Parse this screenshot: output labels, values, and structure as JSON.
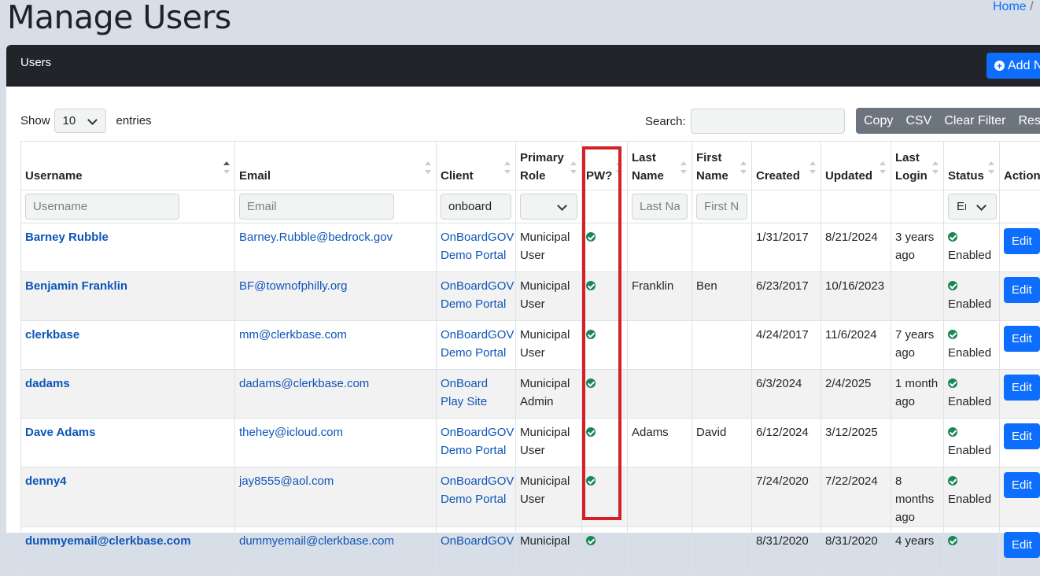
{
  "page": {
    "title": "Manage Users"
  },
  "breadcrumb": {
    "home": "Home",
    "sep": "/"
  },
  "card": {
    "title": "Users",
    "add_label": "Add N"
  },
  "length": {
    "show": "Show",
    "value": "10",
    "entries": "entries"
  },
  "search": {
    "label": "Search:",
    "value": ""
  },
  "buttons": [
    "Copy",
    "CSV",
    "Clear Filter",
    "Reset"
  ],
  "columns": [
    {
      "key": "username",
      "label": "Username"
    },
    {
      "key": "email",
      "label": "Email"
    },
    {
      "key": "client",
      "label": "Client"
    },
    {
      "key": "role",
      "label": "Primary Role"
    },
    {
      "key": "pw",
      "label": "PW?"
    },
    {
      "key": "last",
      "label": "Last Name"
    },
    {
      "key": "first",
      "label": "First Name"
    },
    {
      "key": "created",
      "label": "Created"
    },
    {
      "key": "updated",
      "label": "Updated"
    },
    {
      "key": "login",
      "label": "Last Login"
    },
    {
      "key": "status",
      "label": "Status"
    },
    {
      "key": "action",
      "label": "Action"
    }
  ],
  "filters": {
    "username": "Username",
    "email": "Email",
    "client": "onboard",
    "last": "Last Name",
    "first": "First Name",
    "status": "Enabled"
  },
  "rows": [
    {
      "username": "Barney Rubble",
      "email": "Barney.Rubble@bedrock.gov",
      "client": "OnBoardGOV Demo Portal",
      "role": "Municipal User",
      "last": "",
      "first": "",
      "created": "1/31/2017",
      "updated": "8/21/2024",
      "login": "3 years ago",
      "status": "Enabled",
      "action": "Edit"
    },
    {
      "username": "Benjamin Franklin",
      "email": "BF@townofphilly.org",
      "client": "OnBoardGOV Demo Portal",
      "role": "Municipal User",
      "last": "Franklin",
      "first": "Ben",
      "created": "6/23/2017",
      "updated": "10/16/2023",
      "login": "",
      "status": "Enabled",
      "action": "Edit"
    },
    {
      "username": "clerkbase",
      "email": "mm@clerkbase.com",
      "client": "OnBoardGOV Demo Portal",
      "role": "Municipal User",
      "last": "",
      "first": "",
      "created": "4/24/2017",
      "updated": "11/6/2024",
      "login": "7 years ago",
      "status": "Enabled",
      "action": "Edit"
    },
    {
      "username": "dadams",
      "email": "dadams@clerkbase.com",
      "client": "OnBoard Play Site",
      "role": "Municipal Admin",
      "last": "",
      "first": "",
      "created": "6/3/2024",
      "updated": "2/4/2025",
      "login": "1 month ago",
      "status": "Enabled",
      "action": "Edit"
    },
    {
      "username": "Dave Adams",
      "email": "thehey@icloud.com",
      "client": "OnBoardGOV Demo Portal",
      "role": "Municipal User",
      "last": "Adams",
      "first": "David",
      "created": "6/12/2024",
      "updated": "3/12/2025",
      "login": "",
      "status": "Enabled",
      "action": "Edit"
    },
    {
      "username": "denny4",
      "email": "jay8555@aol.com",
      "client": "OnBoardGOV Demo Portal",
      "role": "Municipal User",
      "last": "",
      "first": "",
      "created": "7/24/2020",
      "updated": "7/22/2024",
      "login": "8 months ago",
      "status": "Enabled",
      "action": "Edit"
    },
    {
      "username": "dummyemail@clerkbase.com",
      "email": "dummyemail@clerkbase.com",
      "client": "OnBoardGOV",
      "role": "Municipal",
      "last": "",
      "first": "",
      "created": "8/31/2020",
      "updated": "8/31/2020",
      "login": "4 years",
      "status": "",
      "action": "Edit"
    }
  ]
}
